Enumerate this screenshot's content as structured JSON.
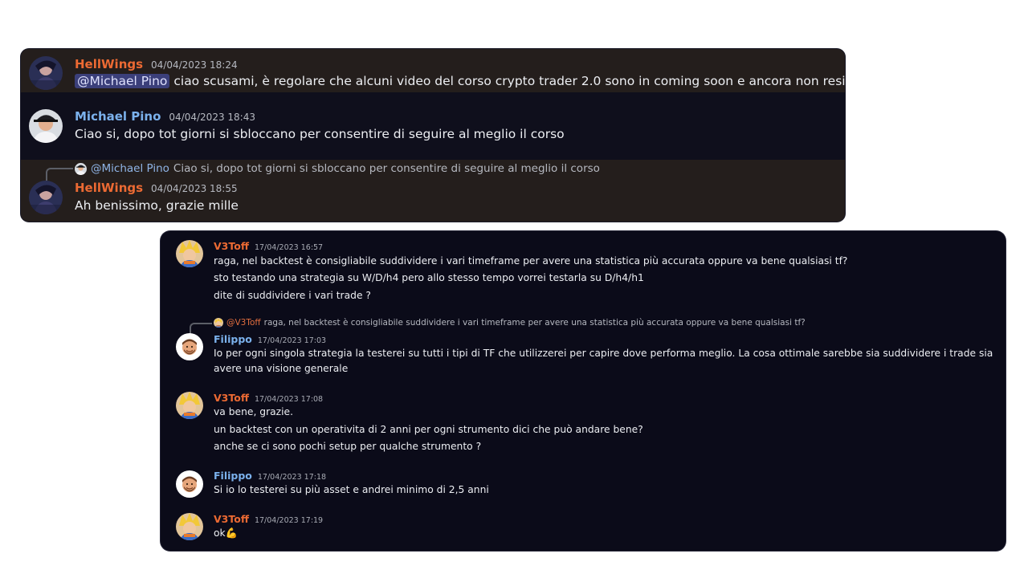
{
  "panel1": {
    "messages": [
      {
        "author": "HellWings",
        "timestamp": "04/04/2023 18:24",
        "mention": "@Michael Pino",
        "text": "ciao scusami, è regolare che alcuni video del corso crypto trader 2.0 sono in coming soon e ancora non resi disponibili?"
      },
      {
        "author": "Michael Pino",
        "timestamp": "04/04/2023 18:43",
        "text": "Ciao si, dopo tot giorni si sbloccano per consentire di seguire al meglio il corso"
      },
      {
        "reply_to_author": "@Michael Pino",
        "reply_to_text": "Ciao si, dopo tot giorni si sbloccano per consentire di seguire al meglio il corso",
        "author": "HellWings",
        "timestamp": "04/04/2023 18:55",
        "text": "Ah benissimo, grazie mille"
      }
    ]
  },
  "panel2": {
    "messages": [
      {
        "author": "V3Toff",
        "timestamp": "17/04/2023 16:57",
        "lines": [
          "raga, nel backtest è consigliabile suddividere i vari timeframe per avere una statistica più accurata oppure va bene qualsiasi tf?",
          "sto testando una strategia su W/D/h4 pero allo stesso tempo vorrei testarla su D/h4/h1",
          "dite di suddividere i vari trade ?"
        ]
      },
      {
        "reply_to_author": "@V3Toff",
        "reply_to_text": "raga, nel backtest è consigliabile suddividere i vari timeframe per avere una statistica più accurata oppure va bene qualsiasi tf?",
        "author": "Filippo",
        "timestamp": "17/04/2023 17:03",
        "text": "Io per ogni singola strategia la testerei su tutti i tipi di TF che utilizzerei per capire dove performa meglio. La cosa ottimale sarebbe sia suddividere i trade sia avere una visione generale"
      },
      {
        "author": "V3Toff",
        "timestamp": "17/04/2023 17:08",
        "lines": [
          "va bene, grazie.",
          "un backtest  con un operativita di 2 anni per ogni strumento dici che può andare bene?",
          "anche se ci sono pochi setup per qualche strumento ?"
        ]
      },
      {
        "author": "Filippo",
        "timestamp": "17/04/2023 17:18",
        "text": "Si io lo testerei su più asset e andrei minimo di 2,5 anni"
      },
      {
        "author": "V3Toff",
        "timestamp": "17/04/2023 17:19",
        "text": "ok",
        "emoji": "💪"
      }
    ]
  },
  "colors": {
    "orange_name": "#ec6a33",
    "blue_name": "#7bb1ec",
    "mention_bg": "#3b3f7a",
    "highlight_bg": "#241e1c"
  },
  "icons": {
    "hellwings_avatar": "hellwings-avatar",
    "michael_avatar": "michael-pino-avatar",
    "v3toff_avatar": "v3toff-avatar",
    "filippo_avatar": "filippo-avatar",
    "emoji": "flexed-biceps"
  }
}
